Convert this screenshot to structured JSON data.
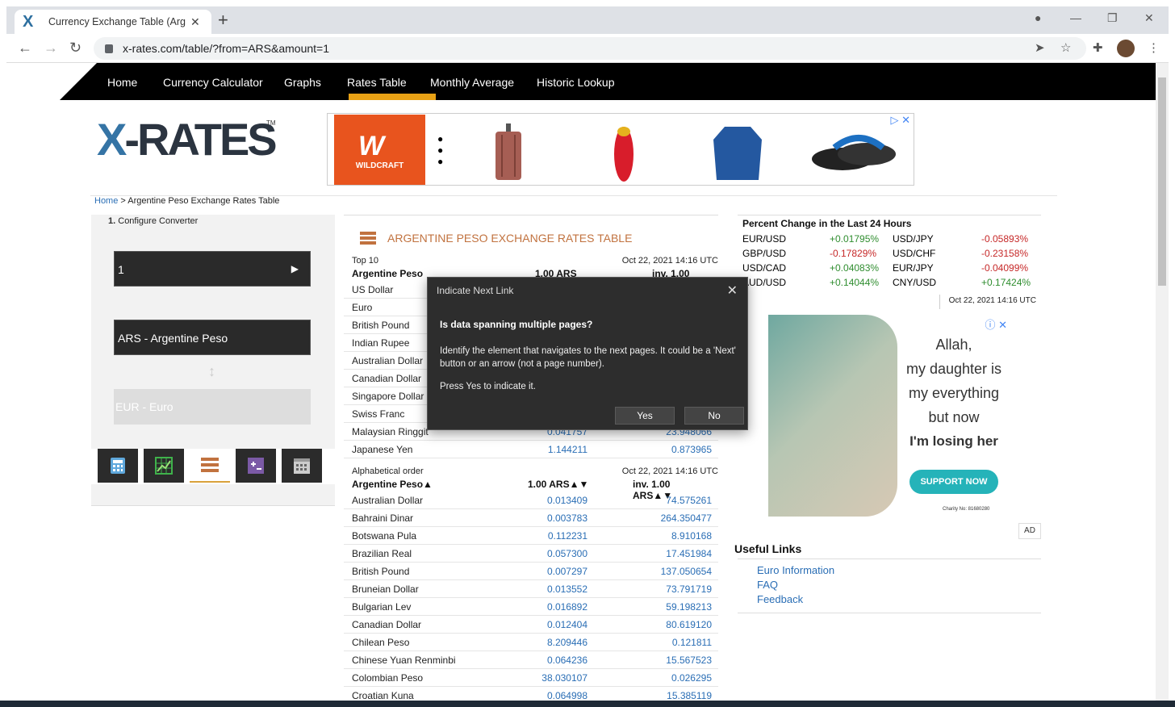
{
  "browser": {
    "tab_title": "Currency Exchange Table (Argent",
    "tab_logo": "X",
    "url": "x-rates.com/table/?from=ARS&amount=1"
  },
  "nav": {
    "items": [
      "Home",
      "Currency Calculator",
      "Graphs",
      "Rates Table",
      "Monthly Average",
      "Historic Lookup"
    ],
    "active": "Rates Table"
  },
  "logo": {
    "x": "X",
    "rest": "-RATES",
    "tm": "TM"
  },
  "ad_banner": {
    "brand": "WILDCRAFT"
  },
  "breadcrumb": {
    "home": "Home",
    "rest": " > Argentine Peso Exchange Rates Table"
  },
  "converter": {
    "step": "1.",
    "title": "Configure Converter",
    "amount": "1",
    "from": "ARS - Argentine Peso",
    "to": "EUR - Euro"
  },
  "table": {
    "title": "ARGENTINE PESO EXCHANGE RATES TABLE",
    "top10_label": "Top 10",
    "date": "Oct 22, 2021 14:16 UTC",
    "base": "Argentine Peso",
    "col1": "1.00 ARS",
    "col2": "inv. 1.00 ARS",
    "top10": [
      {
        "name": "US Dollar",
        "v1": "",
        "v2": ""
      },
      {
        "name": "Euro",
        "v1": "",
        "v2": ""
      },
      {
        "name": "British Pound",
        "v1": "",
        "v2": ""
      },
      {
        "name": "Indian Rupee",
        "v1": "",
        "v2": ""
      },
      {
        "name": "Australian Dollar",
        "v1": "",
        "v2": ""
      },
      {
        "name": "Canadian Dollar",
        "v1": "",
        "v2": ""
      },
      {
        "name": "Singapore Dollar",
        "v1": "",
        "v2": ""
      },
      {
        "name": "Swiss Franc",
        "v1": "",
        "v2": ""
      },
      {
        "name": "Malaysian Ringgit",
        "v1": "0.041757",
        "v2": "23.948066"
      },
      {
        "name": "Japanese Yen",
        "v1": "1.144211",
        "v2": "0.873965"
      }
    ],
    "alpha_label": "Alphabetical order",
    "alpha_base": "Argentine Peso▲",
    "alpha_col1": "1.00 ARS▲▼",
    "alpha_col2": "inv. 1.00 ARS▲▼",
    "alpha": [
      {
        "name": "Australian Dollar",
        "v1": "0.013409",
        "v2": "74.575261"
      },
      {
        "name": "Bahraini Dinar",
        "v1": "0.003783",
        "v2": "264.350477"
      },
      {
        "name": "Botswana Pula",
        "v1": "0.112231",
        "v2": "8.910168"
      },
      {
        "name": "Brazilian Real",
        "v1": "0.057300",
        "v2": "17.451984"
      },
      {
        "name": "British Pound",
        "v1": "0.007297",
        "v2": "137.050654"
      },
      {
        "name": "Bruneian Dollar",
        "v1": "0.013552",
        "v2": "73.791719"
      },
      {
        "name": "Bulgarian Lev",
        "v1": "0.016892",
        "v2": "59.198213"
      },
      {
        "name": "Canadian Dollar",
        "v1": "0.012404",
        "v2": "80.619120"
      },
      {
        "name": "Chilean Peso",
        "v1": "8.209446",
        "v2": "0.121811"
      },
      {
        "name": "Chinese Yuan Renminbi",
        "v1": "0.064236",
        "v2": "15.567523"
      },
      {
        "name": "Colombian Peso",
        "v1": "38.030107",
        "v2": "0.026295"
      },
      {
        "name": "Croatian Kuna",
        "v1": "0.064998",
        "v2": "15.385119"
      }
    ]
  },
  "percent_change": {
    "title": "Percent Change in the Last 24 Hours",
    "rows": [
      {
        "p1": "EUR/USD",
        "c1": "+0.01795%",
        "s1": "pos",
        "p2": "USD/JPY",
        "c2": "-0.05893%",
        "s2": "neg"
      },
      {
        "p1": "GBP/USD",
        "c1": "-0.17829%",
        "s1": "neg",
        "p2": "USD/CHF",
        "c2": "-0.23158%",
        "s2": "neg"
      },
      {
        "p1": "USD/CAD",
        "c1": "+0.04083%",
        "s1": "pos",
        "p2": "EUR/JPY",
        "c2": "-0.04099%",
        "s2": "neg"
      },
      {
        "p1": "AUD/USD",
        "c1": "+0.14044%",
        "s1": "pos",
        "p2": "CNY/USD",
        "c2": "+0.17424%",
        "s2": "pos"
      }
    ],
    "date": "Oct 22, 2021 14:16 UTC",
    "colors": {
      "positive": "#2f8d2f",
      "negative": "#c62828"
    }
  },
  "ad2": {
    "text_lines": [
      "Allah,",
      "my daughter is",
      "my everything",
      "but now"
    ],
    "bold_line": "I'm losing her",
    "button": "SUPPORT NOW",
    "charity": "Charity No: 81680280",
    "ad_tag": "AD"
  },
  "useful_links": {
    "title": "Useful Links",
    "links": [
      "Euro Information",
      "FAQ",
      "Feedback"
    ]
  },
  "dialog": {
    "title": "Indicate Next Link",
    "question": "Is data spanning multiple pages?",
    "body": "Identify the element that navigates to the next pages. It could be a 'Next' button or an arrow (not a page number).",
    "press": "Press Yes to indicate it.",
    "yes": "Yes",
    "no": "No"
  }
}
